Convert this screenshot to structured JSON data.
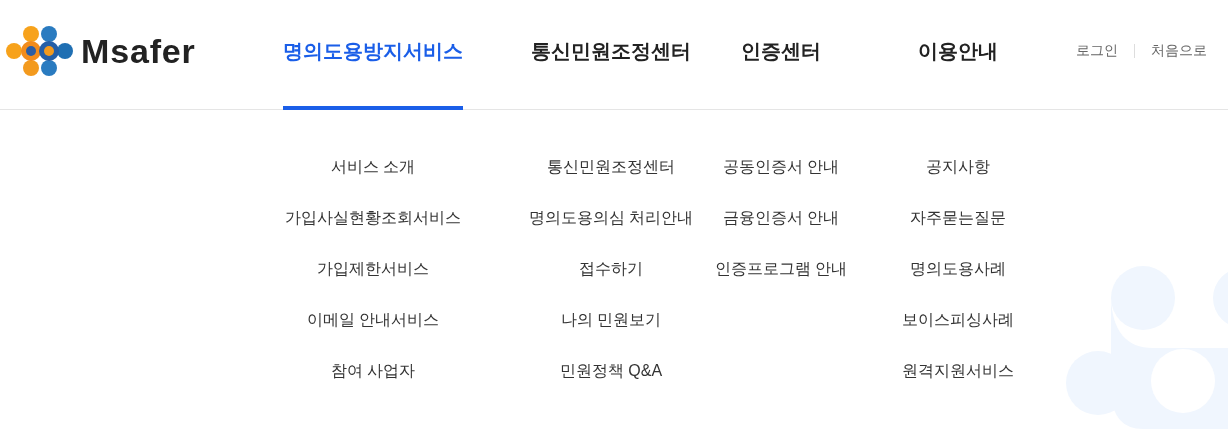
{
  "logo": {
    "text": "Msafer"
  },
  "nav": [
    {
      "label": "명의도용방지서비스",
      "selected": true,
      "items": [
        "서비스 소개",
        "가입사실현황조회서비스",
        "가입제한서비스",
        "이메일 안내서비스",
        "참여 사업자"
      ]
    },
    {
      "label": "통신민원조정센터",
      "selected": false,
      "items": [
        "통신민원조정센터",
        "명의도용의심 처리안내",
        "접수하기",
        "나의 민원보기",
        "민원정책 Q&A"
      ]
    },
    {
      "label": "인증센터",
      "selected": false,
      "items": [
        "공동인증서 안내",
        "금융인증서 안내",
        "인증프로그램 안내"
      ]
    },
    {
      "label": "이용안내",
      "selected": false,
      "items": [
        "공지사항",
        "자주묻는질문",
        "명의도용사례",
        "보이스피싱사례",
        "원격지원서비스"
      ]
    }
  ],
  "utility_links": [
    "로그인",
    "처음으로"
  ]
}
